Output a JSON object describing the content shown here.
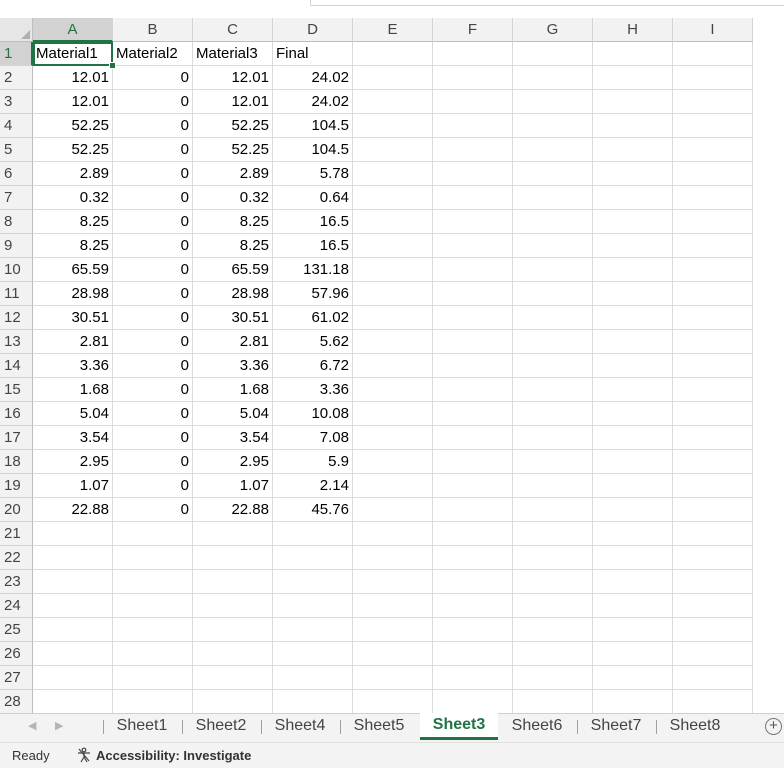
{
  "sheet": {
    "columns": [
      "A",
      "B",
      "C",
      "D",
      "E",
      "F",
      "G",
      "H",
      "I"
    ],
    "row_numbers": [
      "1",
      "2",
      "3",
      "4",
      "5",
      "6",
      "7",
      "8",
      "9",
      "10",
      "11",
      "12",
      "13",
      "14",
      "15",
      "16",
      "17",
      "18",
      "19",
      "20",
      "21",
      "22",
      "23",
      "24",
      "25",
      "26",
      "27",
      "28"
    ],
    "selected_cell": "A1",
    "rows": [
      [
        "Material1",
        "Material2",
        "Material3",
        "Final"
      ],
      [
        "12.01",
        "0",
        "12.01",
        "24.02"
      ],
      [
        "12.01",
        "0",
        "12.01",
        "24.02"
      ],
      [
        "52.25",
        "0",
        "52.25",
        "104.5"
      ],
      [
        "52.25",
        "0",
        "52.25",
        "104.5"
      ],
      [
        "2.89",
        "0",
        "2.89",
        "5.78"
      ],
      [
        "0.32",
        "0",
        "0.32",
        "0.64"
      ],
      [
        "8.25",
        "0",
        "8.25",
        "16.5"
      ],
      [
        "8.25",
        "0",
        "8.25",
        "16.5"
      ],
      [
        "65.59",
        "0",
        "65.59",
        "131.18"
      ],
      [
        "28.98",
        "0",
        "28.98",
        "57.96"
      ],
      [
        "30.51",
        "0",
        "30.51",
        "61.02"
      ],
      [
        "2.81",
        "0",
        "2.81",
        "5.62"
      ],
      [
        "3.36",
        "0",
        "3.36",
        "6.72"
      ],
      [
        "1.68",
        "0",
        "1.68",
        "3.36"
      ],
      [
        "5.04",
        "0",
        "5.04",
        "10.08"
      ],
      [
        "3.54",
        "0",
        "3.54",
        "7.08"
      ],
      [
        "2.95",
        "0",
        "2.95",
        "5.9"
      ],
      [
        "1.07",
        "0",
        "1.07",
        "2.14"
      ],
      [
        "22.88",
        "0",
        "22.88",
        "45.76"
      ]
    ]
  },
  "sheet_tabs": [
    {
      "label": "Sheet1",
      "active": false
    },
    {
      "label": "Sheet2",
      "active": false
    },
    {
      "label": "Sheet4",
      "active": false
    },
    {
      "label": "Sheet5",
      "active": false
    },
    {
      "label": "Sheet3",
      "active": true
    },
    {
      "label": "Sheet6",
      "active": false
    },
    {
      "label": "Sheet7",
      "active": false
    },
    {
      "label": "Sheet8",
      "active": false
    }
  ],
  "add_sheet_icon": "plus-circle-icon",
  "status_bar": {
    "ready": "Ready",
    "accessibility": "Accessibility: Investigate",
    "accessibility_icon": "accessibility-person-icon"
  },
  "colors": {
    "accent": "#217346",
    "header_bg": "#f2f2f2",
    "gridline": "#dadada"
  }
}
